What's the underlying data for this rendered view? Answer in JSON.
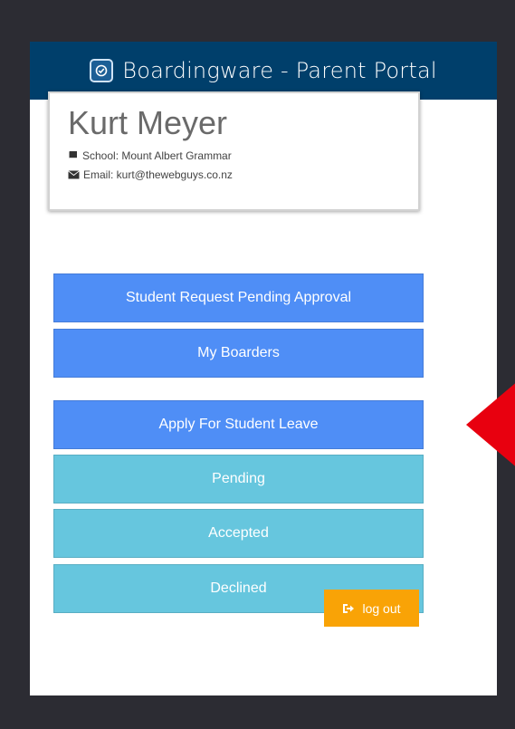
{
  "header": {
    "title": "Boardingware - Parent Portal",
    "logo_icon": "portal-logo-icon"
  },
  "profile": {
    "name": "Kurt Meyer",
    "school": "School: Mount Albert Grammar",
    "email": "Email: kurt@thewebguys.co.nz"
  },
  "menu": {
    "pending_approval": "Student Request Pending Approval",
    "my_boarders": "My Boarders",
    "apply_leave": "Apply For Student Leave",
    "pending": "Pending",
    "accepted": "Accepted",
    "declined": "Declined"
  },
  "logout": {
    "label": "log out"
  },
  "colors": {
    "header": "#003f6b",
    "primary_button": "#4f8ef6",
    "secondary_button": "#66c6de",
    "logout": "#f9a306",
    "annotation_arrow": "#e8000f"
  }
}
